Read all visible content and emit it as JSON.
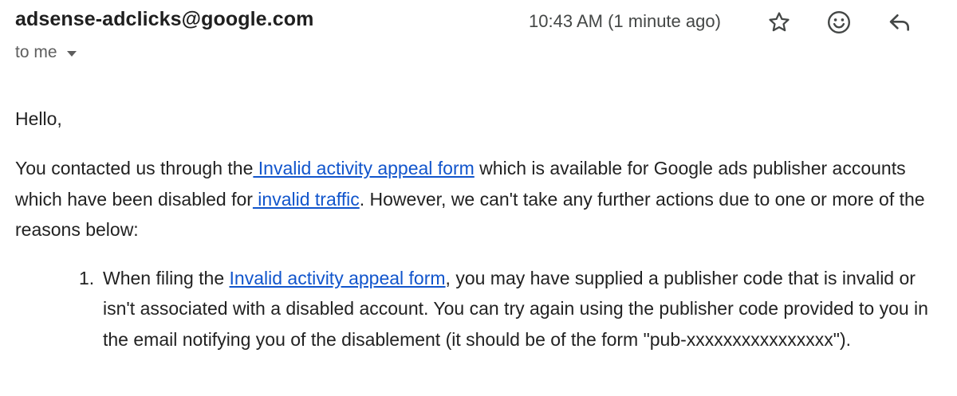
{
  "header": {
    "sender": "adsense-adclicks@google.com",
    "recipient_label": "to me",
    "timestamp": "10:43 AM (1 minute ago)",
    "icons": {
      "star": "star-icon",
      "emoji": "emoji-reaction-icon",
      "reply": "reply-icon",
      "recipient_details": "chevron-down-icon"
    }
  },
  "body": {
    "greeting": "Hello,",
    "intro": {
      "part1": "You contacted us through the",
      "link1": " Invalid activity appeal form",
      "part2": " which is available for Google ads publisher accounts which have been disabled for",
      "link2": " invalid traffic",
      "part3": ". However, we can't take any further actions due to one or more of the reasons below:"
    },
    "reasons": [
      {
        "number": "1.",
        "part1": "When filing the ",
        "link": "Invalid activity appeal form",
        "part2": ", you may have supplied a publisher code that is invalid or isn't associated with a disabled account. You can try again using the publisher code provided to you in the email notifying you of the disablement (it should be of the form \"pub-xxxxxxxxxxxxxxxx\")."
      }
    ]
  },
  "colors": {
    "link": "#1155cc",
    "text": "#222222",
    "muted": "#5e5e5e"
  }
}
